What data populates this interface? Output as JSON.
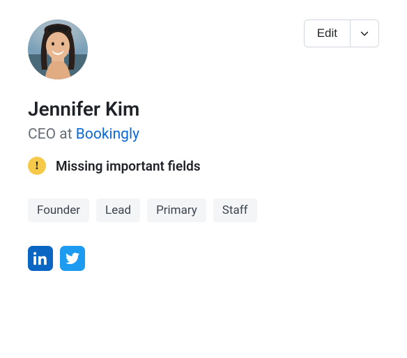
{
  "profile": {
    "name": "Jennifer Kim",
    "role": "CEO",
    "role_connector": " at ",
    "company": "Bookingly"
  },
  "actions": {
    "edit_label": "Edit"
  },
  "warning": {
    "icon_glyph": "!",
    "text": "Missing important fields"
  },
  "tags": {
    "0": "Founder",
    "1": "Lead",
    "2": "Primary",
    "3": "Staff"
  },
  "socials": {
    "linkedin": "linkedin",
    "twitter": "twitter"
  }
}
